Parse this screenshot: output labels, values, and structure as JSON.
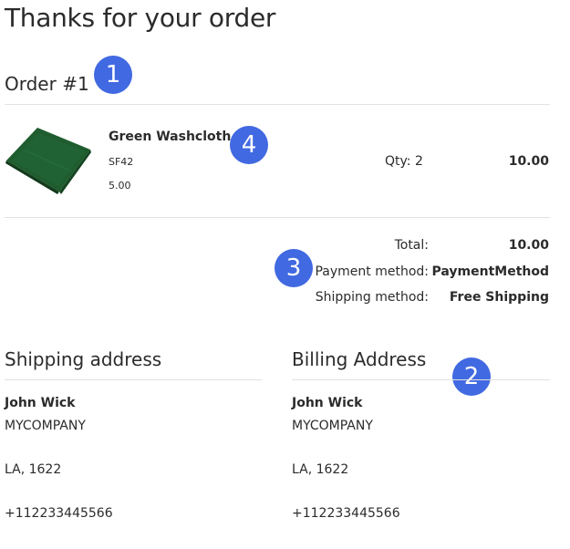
{
  "page": {
    "title": "Thanks for your order"
  },
  "order": {
    "title": "Order #1",
    "item": {
      "name": "Green Washcloth",
      "sku": "SF42",
      "price": "5.00",
      "qty_label": "Qty: 2",
      "line_total": "10.00",
      "image_icon": "green-washcloth-image",
      "image_color": "#1f5c2e"
    }
  },
  "summary": {
    "total_label": "Total:",
    "total_value": "10.00",
    "payment_label": "Payment method:",
    "payment_value": "PaymentMethod",
    "shipping_label": "Shipping method:",
    "shipping_value": "Free Shipping"
  },
  "shipping_address": {
    "heading": "Shipping address",
    "name": "John Wick",
    "company": "MYCOMPANY",
    "city_zip": "LA, 1622",
    "phone": "+112233445566"
  },
  "billing_address": {
    "heading": "Billing Address",
    "name": "John Wick",
    "company": "MYCOMPANY",
    "city_zip": "LA, 1622",
    "phone": "+112233445566"
  },
  "annotations": {
    "badge_color": "#4169e1",
    "labels": [
      "1",
      "2",
      "3",
      "4"
    ]
  }
}
